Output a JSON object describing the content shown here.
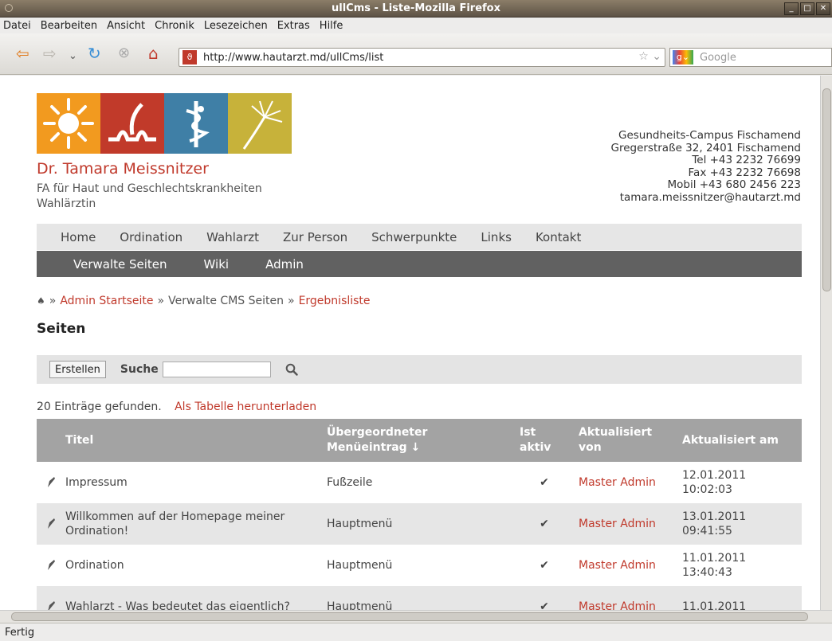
{
  "window": {
    "title": "ullCms - Liste-Mozilla Firefox"
  },
  "menubar": [
    "Datei",
    "Bearbeiten",
    "Ansicht",
    "Chronik",
    "Lesezeichen",
    "Extras",
    "Hilfe"
  ],
  "browser": {
    "url": "http://www.hautarzt.md/ullCms/list",
    "search_placeholder": "Google",
    "status": "Fertig"
  },
  "header": {
    "name": "Dr. Tamara Meissnitzer",
    "subtitle1": "FA für Haut und Geschlechtskrankheiten",
    "subtitle2": "Wahlärztin",
    "contact": {
      "l1": "Gesundheits-Campus Fischamend",
      "l2": "Gregerstraße 32, 2401 Fischamend",
      "l3": "Tel +43 2232 76699",
      "l4": "Fax +43 2232 76698",
      "l5": "Mobil +43 680 2456 223",
      "l6": "tamara.meissnitzer@hautarzt.md"
    }
  },
  "nav": [
    "Home",
    "Ordination",
    "Wahlarzt",
    "Zur Person",
    "Schwerpunkte",
    "Links",
    "Kontakt"
  ],
  "admin_nav": [
    "Verwalte Seiten",
    "Wiki",
    "Admin"
  ],
  "breadcrumb": {
    "sep": "»",
    "c1": "Admin Startseite",
    "c2": "Verwalte CMS Seiten",
    "c3": "Ergebnisliste"
  },
  "page_title": "Seiten",
  "toolbar": {
    "create": "Erstellen",
    "search_label": "Suche"
  },
  "results": {
    "count": "20 Einträge gefunden.",
    "download": "Als Tabelle herunterladen"
  },
  "table": {
    "headers": {
      "title": "Titel",
      "menu1": "Übergeordneter",
      "menu2": "Menüeintrag ↓",
      "aktiv1": "Ist",
      "aktiv2": "aktiv",
      "von1": "Aktualisiert",
      "von2": "von",
      "am": "Aktualisiert am"
    },
    "rows": [
      {
        "title": "Impressum",
        "menu": "Fußzeile",
        "aktiv": "✔",
        "by": "Master Admin",
        "date": "12.01.2011",
        "time": "10:02:03"
      },
      {
        "title": "Willkommen auf der Homepage meiner Ordination!",
        "menu": "Hauptmenü",
        "aktiv": "✔",
        "by": "Master Admin",
        "date": "13.01.2011",
        "time": "09:41:55"
      },
      {
        "title": "Ordination",
        "menu": "Hauptmenü",
        "aktiv": "✔",
        "by": "Master Admin",
        "date": "11.01.2011",
        "time": "13:40:43"
      },
      {
        "title": "Wahlarzt - Was bedeutet das eigentlich?",
        "menu": "Hauptmenü",
        "aktiv": "✔",
        "by": "Master Admin",
        "date": "11.01.2011",
        "time": ""
      }
    ]
  }
}
